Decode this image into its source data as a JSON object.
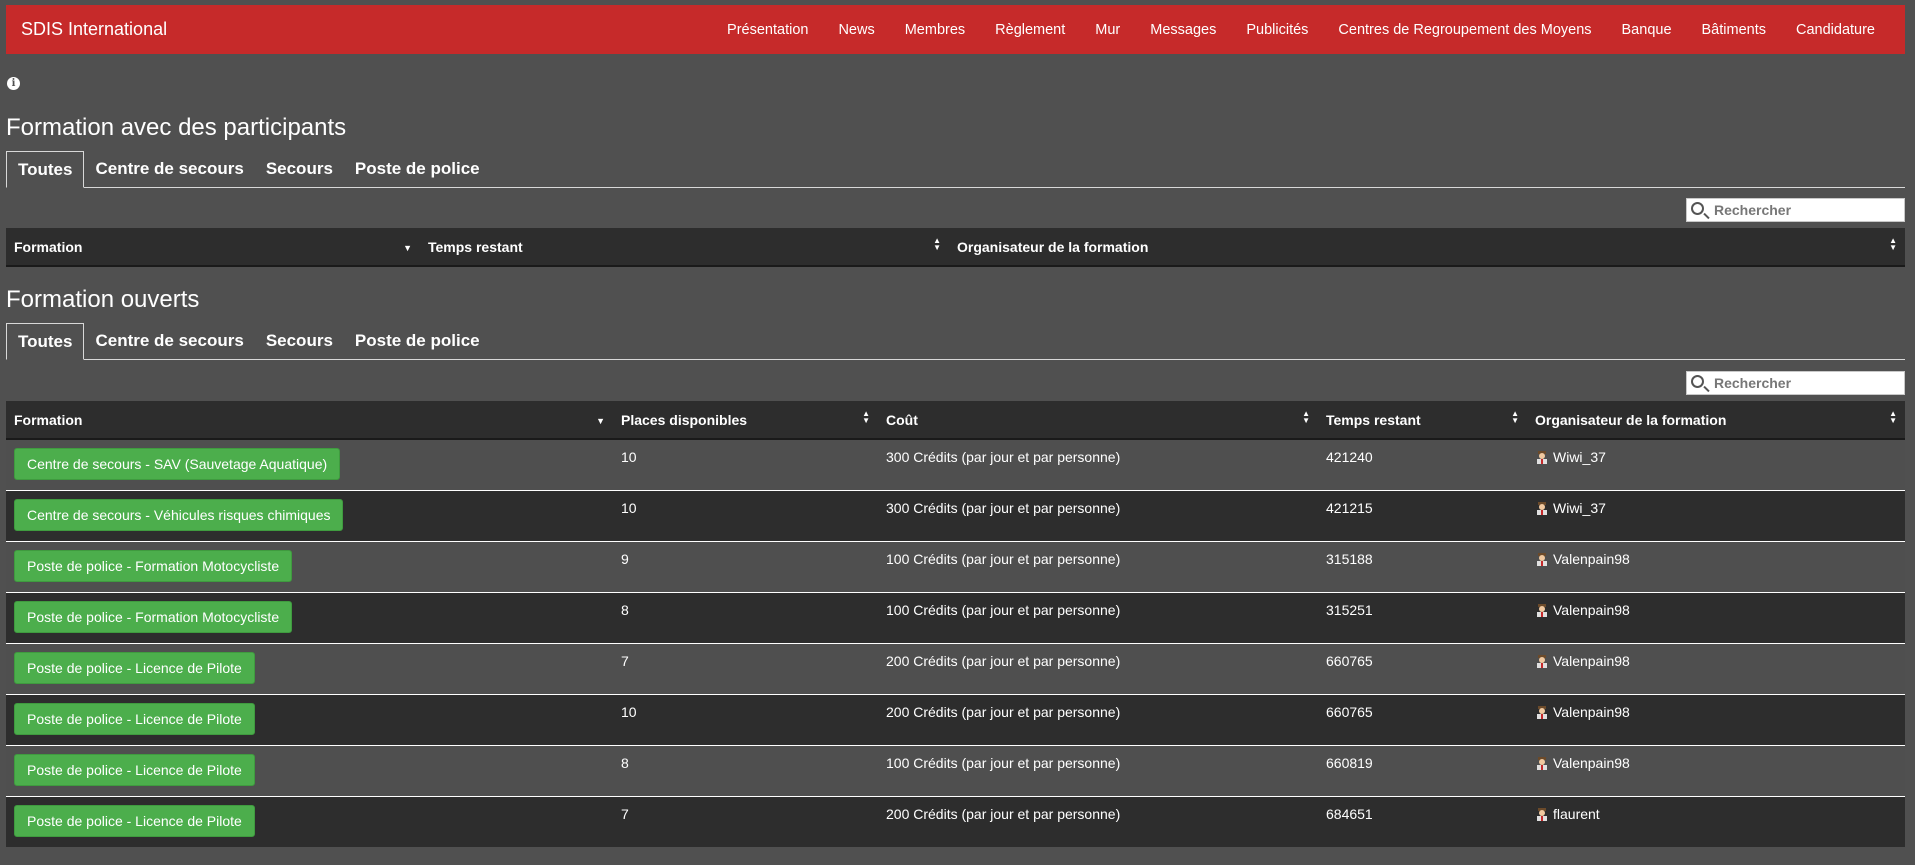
{
  "navbar": {
    "brand": "SDIS International",
    "items": [
      "Présentation",
      "News",
      "Membres",
      "Règlement",
      "Mur",
      "Messages",
      "Publicités",
      "Centres de Regroupement des Moyens",
      "Banque",
      "Bâtiments",
      "Candidature"
    ]
  },
  "info_icon": "info-icon",
  "section1": {
    "title": "Formation avec des participants",
    "tabs": [
      "Toutes",
      "Centre de secours",
      "Secours",
      "Poste de police"
    ],
    "search_placeholder": "Rechercher",
    "columns": [
      "Formation",
      "Temps restant",
      "Organisateur de la formation"
    ]
  },
  "section2": {
    "title": "Formation ouverts",
    "tabs": [
      "Toutes",
      "Centre de secours",
      "Secours",
      "Poste de police"
    ],
    "search_placeholder": "Rechercher",
    "columns": [
      "Formation",
      "Places disponibles",
      "Coût",
      "Temps restant",
      "Organisateur de la formation"
    ],
    "rows": [
      {
        "formation": "Centre de secours - SAV (Sauvetage Aquatique)",
        "places": "10",
        "cout": "300 Crédits (par jour et par personne)",
        "temps": "421240",
        "organisateur": "Wiwi_37"
      },
      {
        "formation": "Centre de secours - Véhicules risques chimiques",
        "places": "10",
        "cout": "300 Crédits (par jour et par personne)",
        "temps": "421215",
        "organisateur": "Wiwi_37"
      },
      {
        "formation": "Poste de police - Formation Motocycliste",
        "places": "9",
        "cout": "100 Crédits (par jour et par personne)",
        "temps": "315188",
        "organisateur": "Valenpain98"
      },
      {
        "formation": "Poste de police - Formation Motocycliste",
        "places": "8",
        "cout": "100 Crédits (par jour et par personne)",
        "temps": "315251",
        "organisateur": "Valenpain98"
      },
      {
        "formation": "Poste de police - Licence de Pilote",
        "places": "7",
        "cout": "200 Crédits (par jour et par personne)",
        "temps": "660765",
        "organisateur": "Valenpain98"
      },
      {
        "formation": "Poste de police - Licence de Pilote",
        "places": "10",
        "cout": "200 Crédits (par jour et par personne)",
        "temps": "660765",
        "organisateur": "Valenpain98"
      },
      {
        "formation": "Poste de police - Licence de Pilote",
        "places": "8",
        "cout": "100 Crédits (par jour et par personne)",
        "temps": "660819",
        "organisateur": "Valenpain98"
      },
      {
        "formation": "Poste de police - Licence de Pilote",
        "places": "7",
        "cout": "200 Crédits (par jour et par personne)",
        "temps": "684651",
        "organisateur": "flaurent"
      }
    ]
  },
  "colors": {
    "navbar": "#c62a2a",
    "background": "#505050",
    "header_row": "#2d2d2d",
    "button": "#4cae4c"
  },
  "icons": {
    "user": "user-icon",
    "search": "search-icon",
    "sort": "sort-icon"
  }
}
